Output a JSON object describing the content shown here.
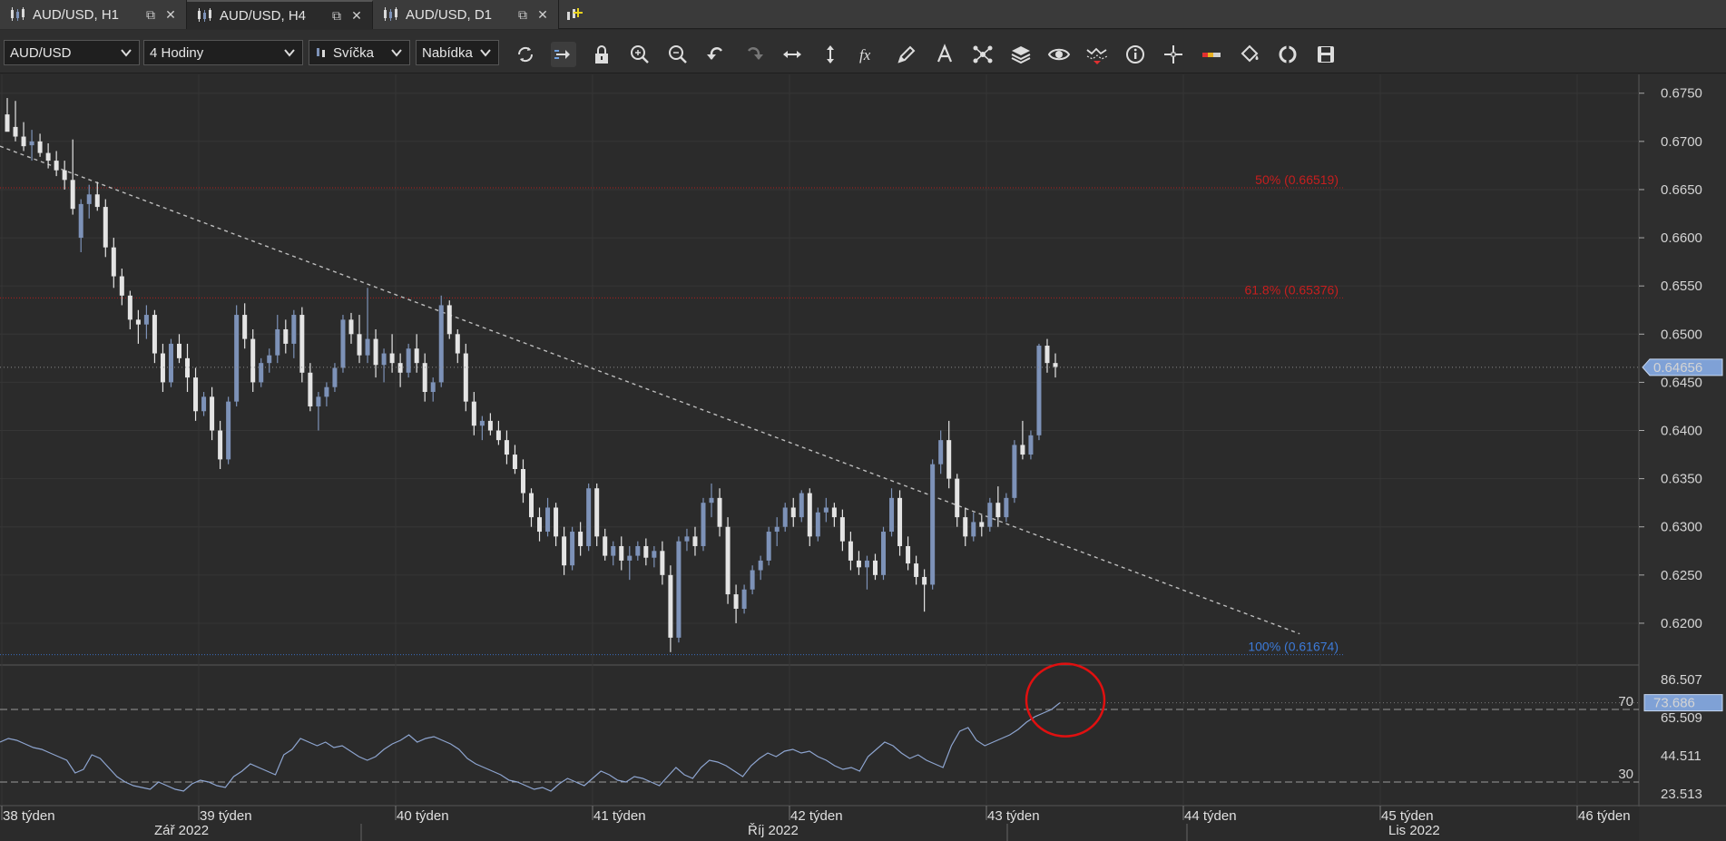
{
  "tabs": [
    {
      "label": "AUD/USD, H1",
      "active": false
    },
    {
      "label": "AUD/USD, H4",
      "active": true
    },
    {
      "label": "AUD/USD, D1",
      "active": false
    }
  ],
  "toolbar": {
    "instrument": "AUD/USD",
    "period": "4 Hodiny",
    "chart_type": "Svíčka",
    "price_side": "Nabídka",
    "buttons": [
      "refresh-icon",
      "autoshift-icon",
      "lock-icon",
      "zoom-in-icon",
      "zoom-out-icon",
      "undo-icon",
      "redo-icon",
      "horizontal-scale-icon",
      "vertical-scale-icon",
      "indicators-fx-icon",
      "pencil-draw-icon",
      "text-tool-icon",
      "pattern-icon",
      "layers-icon",
      "visibility-eye-icon",
      "alerts-icon",
      "info-icon",
      "crosshair-icon",
      "color-bar-icon",
      "paint-bucket-icon",
      "template-icon",
      "save-icon"
    ]
  },
  "colors": {
    "background": "#2b2b2b",
    "bull_candle": "#7d92b8",
    "bear_candle": "#e4e4e4",
    "fib_red": "#c81e1e",
    "fib_blue": "#3c7ad8",
    "rsi_line": "#8ea5d0",
    "marker_circle": "#e01010"
  },
  "chart_data": {
    "type": "candlestick",
    "symbol": "AUD/USD",
    "timeframe": "H4",
    "price_axis": {
      "ticks": [
        "0.6750",
        "0.6700",
        "0.6650",
        "0.6600",
        "0.6550",
        "0.6500",
        "0.6450",
        "0.6400",
        "0.6350",
        "0.6300",
        "0.6250",
        "0.6200"
      ],
      "ylim": [
        0.6167,
        0.6762
      ],
      "current_price": "0.64656"
    },
    "fib_levels": [
      {
        "label": "50% (0.66519)",
        "value": 0.66519,
        "color": "#c81e1e"
      },
      {
        "label": "61.8% (0.65376)",
        "value": 0.65376,
        "color": "#c81e1e"
      },
      {
        "label": "100% (0.61674)",
        "value": 0.61674,
        "color": "#3c7ad8"
      }
    ],
    "trendline": {
      "from": {
        "week_pos": 0.0,
        "price": 0.6695
      },
      "to": {
        "week_pos": 6.6,
        "price": 0.6189
      }
    },
    "candles": [
      [
        0.6728,
        0.6745,
        0.6715,
        0.671
      ],
      [
        0.6715,
        0.6742,
        0.67,
        0.6705
      ],
      [
        0.6705,
        0.672,
        0.669,
        0.6695
      ],
      [
        0.6696,
        0.6712,
        0.668,
        0.67
      ],
      [
        0.67,
        0.6708,
        0.6684,
        0.6688
      ],
      [
        0.6688,
        0.6698,
        0.6672,
        0.668
      ],
      [
        0.668,
        0.669,
        0.6664,
        0.667
      ],
      [
        0.667,
        0.668,
        0.665,
        0.666
      ],
      [
        0.666,
        0.6702,
        0.6624,
        0.663
      ],
      [
        0.66,
        0.664,
        0.6585,
        0.6635
      ],
      [
        0.6635,
        0.6655,
        0.662,
        0.6645
      ],
      [
        0.6645,
        0.6658,
        0.6628,
        0.6632
      ],
      [
        0.6632,
        0.664,
        0.658,
        0.659
      ],
      [
        0.659,
        0.66,
        0.6548,
        0.656
      ],
      [
        0.656,
        0.6568,
        0.653,
        0.654
      ],
      [
        0.654,
        0.6545,
        0.6505,
        0.6515
      ],
      [
        0.6515,
        0.6525,
        0.649,
        0.651
      ],
      [
        0.651,
        0.653,
        0.6495,
        0.652
      ],
      [
        0.652,
        0.6525,
        0.647,
        0.648
      ],
      [
        0.648,
        0.649,
        0.644,
        0.645
      ],
      [
        0.645,
        0.6495,
        0.6445,
        0.649
      ],
      [
        0.649,
        0.65,
        0.647,
        0.6475
      ],
      [
        0.6475,
        0.649,
        0.644,
        0.6455
      ],
      [
        0.6455,
        0.6465,
        0.641,
        0.642
      ],
      [
        0.642,
        0.644,
        0.6415,
        0.6435
      ],
      [
        0.6435,
        0.6445,
        0.639,
        0.64
      ],
      [
        0.64,
        0.641,
        0.636,
        0.637
      ],
      [
        0.637,
        0.6435,
        0.6365,
        0.643
      ],
      [
        0.643,
        0.653,
        0.6425,
        0.652
      ],
      [
        0.652,
        0.6532,
        0.6485,
        0.6495
      ],
      [
        0.6495,
        0.6505,
        0.644,
        0.645
      ],
      [
        0.645,
        0.6475,
        0.6445,
        0.647
      ],
      [
        0.647,
        0.6485,
        0.646,
        0.6478
      ],
      [
        0.6478,
        0.652,
        0.647,
        0.6505
      ],
      [
        0.6505,
        0.6515,
        0.648,
        0.649
      ],
      [
        0.649,
        0.6525,
        0.6475,
        0.652
      ],
      [
        0.652,
        0.6528,
        0.645,
        0.646
      ],
      [
        0.646,
        0.647,
        0.642,
        0.6425
      ],
      [
        0.6425,
        0.644,
        0.64,
        0.6435
      ],
      [
        0.6435,
        0.645,
        0.6425,
        0.6445
      ],
      [
        0.6445,
        0.647,
        0.644,
        0.6465
      ],
      [
        0.6465,
        0.652,
        0.646,
        0.6515
      ],
      [
        0.6515,
        0.6522,
        0.649,
        0.65
      ],
      [
        0.65,
        0.652,
        0.647,
        0.6478
      ],
      [
        0.6478,
        0.6548,
        0.647,
        0.6495
      ],
      [
        0.6495,
        0.6505,
        0.6455,
        0.6468
      ],
      [
        0.6468,
        0.6485,
        0.645,
        0.648
      ],
      [
        0.648,
        0.65,
        0.646,
        0.647
      ],
      [
        0.647,
        0.648,
        0.6445,
        0.646
      ],
      [
        0.646,
        0.649,
        0.6455,
        0.6485
      ],
      [
        0.6485,
        0.65,
        0.646,
        0.647
      ],
      [
        0.647,
        0.648,
        0.643,
        0.644
      ],
      [
        0.644,
        0.6455,
        0.643,
        0.645
      ],
      [
        0.645,
        0.654,
        0.6445,
        0.653
      ],
      [
        0.653,
        0.6535,
        0.6495,
        0.65
      ],
      [
        0.65,
        0.6505,
        0.647,
        0.648
      ],
      [
        0.648,
        0.649,
        0.642,
        0.643
      ],
      [
        0.643,
        0.644,
        0.6395,
        0.6405
      ],
      [
        0.6405,
        0.6415,
        0.639,
        0.641
      ],
      [
        0.641,
        0.6418,
        0.6395,
        0.64
      ],
      [
        0.64,
        0.641,
        0.6385,
        0.639
      ],
      [
        0.639,
        0.64,
        0.6365,
        0.6375
      ],
      [
        0.6375,
        0.6385,
        0.6355,
        0.636
      ],
      [
        0.636,
        0.637,
        0.6325,
        0.6335
      ],
      [
        0.6335,
        0.634,
        0.63,
        0.631
      ],
      [
        0.631,
        0.632,
        0.6285,
        0.6295
      ],
      [
        0.6295,
        0.633,
        0.629,
        0.632
      ],
      [
        0.632,
        0.6325,
        0.628,
        0.629
      ],
      [
        0.629,
        0.63,
        0.625,
        0.626
      ],
      [
        0.626,
        0.63,
        0.6255,
        0.6295
      ],
      [
        0.6295,
        0.6305,
        0.627,
        0.628
      ],
      [
        0.628,
        0.6345,
        0.6275,
        0.634
      ],
      [
        0.634,
        0.6345,
        0.628,
        0.629
      ],
      [
        0.629,
        0.6298,
        0.6265,
        0.627
      ],
      [
        0.627,
        0.6285,
        0.626,
        0.628
      ],
      [
        0.628,
        0.629,
        0.6255,
        0.6265
      ],
      [
        0.6265,
        0.628,
        0.6245,
        0.627
      ],
      [
        0.627,
        0.6285,
        0.6265,
        0.628
      ],
      [
        0.628,
        0.6288,
        0.626,
        0.6268
      ],
      [
        0.6268,
        0.628,
        0.6258,
        0.6275
      ],
      [
        0.6275,
        0.6285,
        0.624,
        0.625
      ],
      [
        0.625,
        0.626,
        0.617,
        0.6185
      ],
      [
        0.6185,
        0.629,
        0.618,
        0.6285
      ],
      [
        0.6285,
        0.6298,
        0.6275,
        0.629
      ],
      [
        0.629,
        0.63,
        0.627,
        0.628
      ],
      [
        0.628,
        0.633,
        0.6275,
        0.6325
      ],
      [
        0.6325,
        0.6345,
        0.631,
        0.633
      ],
      [
        0.633,
        0.634,
        0.629,
        0.63
      ],
      [
        0.63,
        0.631,
        0.622,
        0.623
      ],
      [
        0.623,
        0.624,
        0.62,
        0.6215
      ],
      [
        0.6215,
        0.624,
        0.621,
        0.6235
      ],
      [
        0.6235,
        0.626,
        0.623,
        0.6255
      ],
      [
        0.6255,
        0.627,
        0.6245,
        0.6265
      ],
      [
        0.6265,
        0.63,
        0.626,
        0.6295
      ],
      [
        0.6295,
        0.631,
        0.628,
        0.63
      ],
      [
        0.63,
        0.6325,
        0.6295,
        0.632
      ],
      [
        0.632,
        0.633,
        0.63,
        0.631
      ],
      [
        0.631,
        0.6338,
        0.6305,
        0.6335
      ],
      [
        0.6335,
        0.634,
        0.628,
        0.629
      ],
      [
        0.629,
        0.632,
        0.6285,
        0.6315
      ],
      [
        0.6315,
        0.633,
        0.6305,
        0.632
      ],
      [
        0.632,
        0.6325,
        0.63,
        0.631
      ],
      [
        0.631,
        0.6318,
        0.6275,
        0.6285
      ],
      [
        0.6285,
        0.6295,
        0.6255,
        0.6265
      ],
      [
        0.6265,
        0.6275,
        0.625,
        0.6258
      ],
      [
        0.6258,
        0.627,
        0.6235,
        0.6265
      ],
      [
        0.6265,
        0.6272,
        0.6245,
        0.625
      ],
      [
        0.625,
        0.63,
        0.6245,
        0.6295
      ],
      [
        0.6295,
        0.634,
        0.629,
        0.633
      ],
      [
        0.633,
        0.6338,
        0.627,
        0.628
      ],
      [
        0.628,
        0.629,
        0.6255,
        0.6262
      ],
      [
        0.6262,
        0.627,
        0.624,
        0.6248
      ],
      [
        0.6248,
        0.6256,
        0.6212,
        0.624
      ],
      [
        0.624,
        0.637,
        0.6235,
        0.6365
      ],
      [
        0.6365,
        0.64,
        0.6355,
        0.639
      ],
      [
        0.639,
        0.641,
        0.634,
        0.635
      ],
      [
        0.635,
        0.6355,
        0.63,
        0.631
      ],
      [
        0.631,
        0.632,
        0.628,
        0.629
      ],
      [
        0.629,
        0.6315,
        0.6285,
        0.6305
      ],
      [
        0.6305,
        0.6312,
        0.629,
        0.63
      ],
      [
        0.63,
        0.633,
        0.6295,
        0.6325
      ],
      [
        0.6325,
        0.6342,
        0.63,
        0.631
      ],
      [
        0.631,
        0.6335,
        0.6305,
        0.633
      ],
      [
        0.633,
        0.639,
        0.6325,
        0.6385
      ],
      [
        0.6385,
        0.641,
        0.637,
        0.6375
      ],
      [
        0.6375,
        0.64,
        0.637,
        0.6395
      ],
      [
        0.6395,
        0.649,
        0.639,
        0.6488
      ],
      [
        0.6488,
        0.6495,
        0.646,
        0.647
      ],
      [
        0.647,
        0.648,
        0.6455,
        0.6466
      ]
    ],
    "rsi": {
      "name": "RSI",
      "axis_ticks": [
        "86.507",
        "65.509",
        "44.511",
        "23.513"
      ],
      "ylim": [
        20.0,
        90.0
      ],
      "levels": [
        70,
        30
      ],
      "current": "73.686",
      "values": [
        52,
        54,
        53,
        51,
        49,
        48,
        46,
        44,
        42,
        35,
        37,
        45,
        43,
        38,
        33,
        30,
        28,
        27,
        26,
        30,
        28,
        26,
        25,
        29,
        31,
        30,
        28,
        27,
        33,
        36,
        40,
        38,
        36,
        34,
        45,
        48,
        54,
        52,
        50,
        52,
        49,
        50,
        47,
        44,
        42,
        44,
        48,
        51,
        53,
        56,
        52,
        54,
        55,
        53,
        51,
        48,
        43,
        40,
        38,
        36,
        34,
        31,
        30,
        28,
        26,
        27,
        25,
        29,
        32,
        30,
        28,
        32,
        36,
        34,
        31,
        30,
        33,
        32,
        30,
        28,
        33,
        38,
        34,
        32,
        38,
        42,
        41,
        39,
        36,
        33,
        39,
        43,
        46,
        44,
        47,
        48,
        46,
        47,
        44,
        42,
        39,
        37,
        38,
        36,
        44,
        48,
        52,
        50,
        46,
        43,
        45,
        42,
        40,
        38,
        50,
        58,
        60,
        53,
        50,
        52,
        54,
        56,
        59,
        63,
        66,
        68,
        70,
        73.686
      ]
    },
    "time_axis": {
      "weeks": [
        "38 týden",
        "39 týden",
        "40 týden",
        "41 týden",
        "42 týden",
        "43 týden",
        "44 týden",
        "45 týden",
        "46 týden"
      ],
      "months": [
        "Zář 2022",
        "Říj 2022",
        "Lis 2022"
      ]
    },
    "annotation": {
      "type": "circle",
      "color": "#e01010"
    }
  }
}
